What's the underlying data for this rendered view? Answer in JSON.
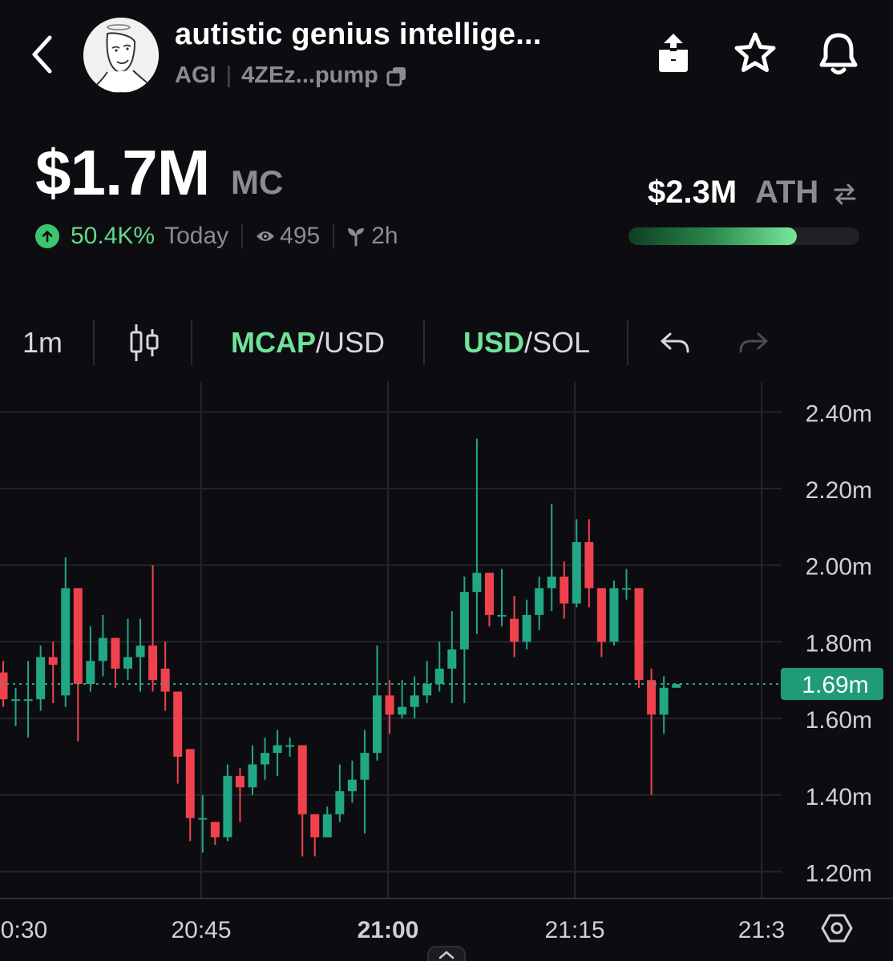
{
  "header": {
    "token_name": "autistic genius intellige...",
    "ticker": "AGI",
    "address": "4ZEz...pump",
    "icons": [
      "back-icon",
      "share-icon",
      "star-icon",
      "bell-icon",
      "copy-icon"
    ]
  },
  "market": {
    "mc_value": "$1.7M",
    "mc_label": "MC",
    "change_value": "50.4K%",
    "change_period": "Today",
    "watchers": "495",
    "age": "2h",
    "ath_value": "$2.3M",
    "ath_label": "ATH",
    "ath_progress": 0.73
  },
  "toolbar": {
    "interval": "1m",
    "mcap_label": "MCAP",
    "mcap_suffix": "/USD",
    "usd_label": "USD",
    "usd_suffix": "/SOL"
  },
  "colors": {
    "up": "#22a785",
    "down": "#f0424e",
    "accent": "#6fe39a",
    "price_tag": "#1f9b78"
  },
  "chart_data": {
    "type": "candlestick",
    "y_axis_labels": [
      "2.40m",
      "2.20m",
      "2.00m",
      "1.80m",
      "1.60m",
      "1.40m",
      "1.20m"
    ],
    "y_ticks": [
      2.4,
      2.2,
      2.0,
      1.8,
      1.6,
      1.4,
      1.2
    ],
    "ylim": [
      1.13,
      2.48
    ],
    "x_axis_labels": [
      "0:30",
      "20:45",
      "21:00",
      "21:15",
      "21:3"
    ],
    "current_price_label": "1.69m",
    "current_price": 1.69,
    "candles": [
      [
        1.72,
        1.65,
        1.75,
        1.63
      ],
      [
        1.65,
        1.65,
        1.68,
        1.58
      ],
      [
        1.65,
        1.65,
        1.75,
        1.55
      ],
      [
        1.65,
        1.76,
        1.79,
        1.62
      ],
      [
        1.76,
        1.74,
        1.8,
        1.64
      ],
      [
        1.66,
        1.94,
        2.02,
        1.63
      ],
      [
        1.94,
        1.69,
        1.94,
        1.54
      ],
      [
        1.69,
        1.75,
        1.84,
        1.67
      ],
      [
        1.75,
        1.81,
        1.87,
        1.71
      ],
      [
        1.81,
        1.73,
        1.81,
        1.68
      ],
      [
        1.73,
        1.76,
        1.86,
        1.7
      ],
      [
        1.76,
        1.79,
        1.86,
        1.67
      ],
      [
        1.79,
        1.7,
        2.0,
        1.67
      ],
      [
        1.73,
        1.67,
        1.8,
        1.62
      ],
      [
        1.67,
        1.5,
        1.67,
        1.43
      ],
      [
        1.52,
        1.34,
        1.52,
        1.28
      ],
      [
        1.34,
        1.34,
        1.4,
        1.25
      ],
      [
        1.33,
        1.29,
        1.33,
        1.27
      ],
      [
        1.29,
        1.45,
        1.48,
        1.28
      ],
      [
        1.45,
        1.42,
        1.47,
        1.33
      ],
      [
        1.42,
        1.48,
        1.53,
        1.4
      ],
      [
        1.48,
        1.51,
        1.55,
        1.44
      ],
      [
        1.51,
        1.53,
        1.57,
        1.45
      ],
      [
        1.53,
        1.53,
        1.55,
        1.5
      ],
      [
        1.53,
        1.35,
        1.53,
        1.24
      ],
      [
        1.35,
        1.29,
        1.35,
        1.24
      ],
      [
        1.29,
        1.35,
        1.37,
        1.29
      ],
      [
        1.35,
        1.41,
        1.48,
        1.33
      ],
      [
        1.41,
        1.44,
        1.49,
        1.38
      ],
      [
        1.44,
        1.51,
        1.57,
        1.3
      ],
      [
        1.51,
        1.66,
        1.79,
        1.49
      ],
      [
        1.66,
        1.61,
        1.7,
        1.56
      ],
      [
        1.61,
        1.63,
        1.7,
        1.6
      ],
      [
        1.63,
        1.66,
        1.71,
        1.6
      ],
      [
        1.66,
        1.69,
        1.75,
        1.64
      ],
      [
        1.69,
        1.73,
        1.8,
        1.67
      ],
      [
        1.73,
        1.78,
        1.88,
        1.64
      ],
      [
        1.78,
        1.93,
        1.97,
        1.64
      ],
      [
        1.93,
        1.98,
        2.33,
        1.82
      ],
      [
        1.98,
        1.87,
        1.98,
        1.84
      ],
      [
        1.87,
        1.87,
        1.99,
        1.84
      ],
      [
        1.86,
        1.8,
        1.92,
        1.76
      ],
      [
        1.8,
        1.87,
        1.91,
        1.78
      ],
      [
        1.87,
        1.94,
        1.97,
        1.83
      ],
      [
        1.94,
        1.97,
        2.16,
        1.88
      ],
      [
        1.97,
        1.9,
        2.01,
        1.86
      ],
      [
        1.9,
        2.06,
        2.12,
        1.89
      ],
      [
        2.06,
        1.94,
        2.12,
        1.89
      ],
      [
        1.94,
        1.8,
        1.94,
        1.76
      ],
      [
        1.8,
        1.94,
        1.96,
        1.79
      ],
      [
        1.94,
        1.94,
        1.99,
        1.91
      ],
      [
        1.94,
        1.7,
        1.94,
        1.68
      ],
      [
        1.7,
        1.61,
        1.73,
        1.4
      ],
      [
        1.61,
        1.68,
        1.71,
        1.56
      ],
      [
        1.68,
        1.69,
        1.69,
        1.68
      ]
    ]
  }
}
